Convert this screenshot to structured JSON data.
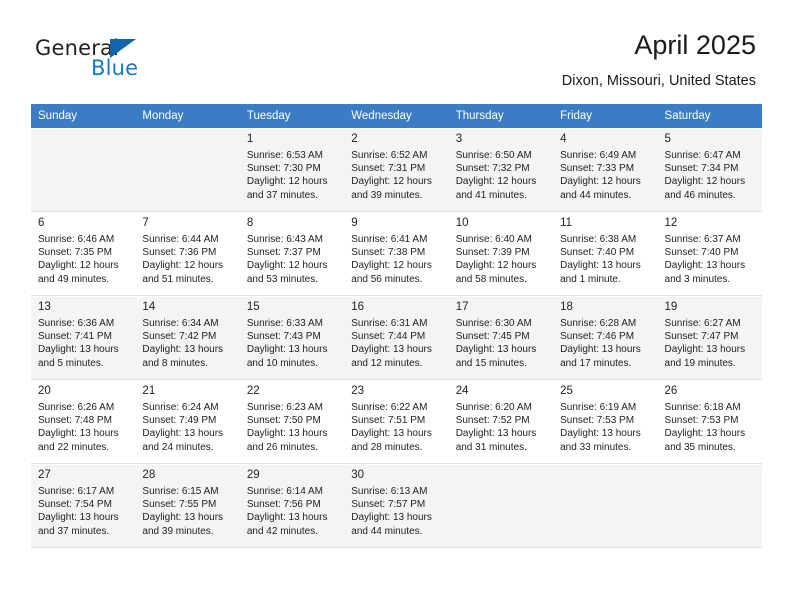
{
  "brand": {
    "name_part1": "General",
    "name_part2": "Blue",
    "logo_icon": "triangle-icon",
    "accent_color": "#1878c8"
  },
  "header": {
    "title": "April 2025",
    "location": "Dixon, Missouri, United States"
  },
  "calendar": {
    "header_bg": "#3b7dc4",
    "columns": [
      "Sunday",
      "Monday",
      "Tuesday",
      "Wednesday",
      "Thursday",
      "Friday",
      "Saturday"
    ],
    "weeks": [
      [
        {
          "day": "",
          "sunrise": "",
          "sunset": "",
          "daylight1": "",
          "daylight2": ""
        },
        {
          "day": "",
          "sunrise": "",
          "sunset": "",
          "daylight1": "",
          "daylight2": ""
        },
        {
          "day": "1",
          "sunrise": "Sunrise: 6:53 AM",
          "sunset": "Sunset: 7:30 PM",
          "daylight1": "Daylight: 12 hours",
          "daylight2": "and 37 minutes."
        },
        {
          "day": "2",
          "sunrise": "Sunrise: 6:52 AM",
          "sunset": "Sunset: 7:31 PM",
          "daylight1": "Daylight: 12 hours",
          "daylight2": "and 39 minutes."
        },
        {
          "day": "3",
          "sunrise": "Sunrise: 6:50 AM",
          "sunset": "Sunset: 7:32 PM",
          "daylight1": "Daylight: 12 hours",
          "daylight2": "and 41 minutes."
        },
        {
          "day": "4",
          "sunrise": "Sunrise: 6:49 AM",
          "sunset": "Sunset: 7:33 PM",
          "daylight1": "Daylight: 12 hours",
          "daylight2": "and 44 minutes."
        },
        {
          "day": "5",
          "sunrise": "Sunrise: 6:47 AM",
          "sunset": "Sunset: 7:34 PM",
          "daylight1": "Daylight: 12 hours",
          "daylight2": "and 46 minutes."
        }
      ],
      [
        {
          "day": "6",
          "sunrise": "Sunrise: 6:46 AM",
          "sunset": "Sunset: 7:35 PM",
          "daylight1": "Daylight: 12 hours",
          "daylight2": "and 49 minutes."
        },
        {
          "day": "7",
          "sunrise": "Sunrise: 6:44 AM",
          "sunset": "Sunset: 7:36 PM",
          "daylight1": "Daylight: 12 hours",
          "daylight2": "and 51 minutes."
        },
        {
          "day": "8",
          "sunrise": "Sunrise: 6:43 AM",
          "sunset": "Sunset: 7:37 PM",
          "daylight1": "Daylight: 12 hours",
          "daylight2": "and 53 minutes."
        },
        {
          "day": "9",
          "sunrise": "Sunrise: 6:41 AM",
          "sunset": "Sunset: 7:38 PM",
          "daylight1": "Daylight: 12 hours",
          "daylight2": "and 56 minutes."
        },
        {
          "day": "10",
          "sunrise": "Sunrise: 6:40 AM",
          "sunset": "Sunset: 7:39 PM",
          "daylight1": "Daylight: 12 hours",
          "daylight2": "and 58 minutes."
        },
        {
          "day": "11",
          "sunrise": "Sunrise: 6:38 AM",
          "sunset": "Sunset: 7:40 PM",
          "daylight1": "Daylight: 13 hours",
          "daylight2": "and 1 minute."
        },
        {
          "day": "12",
          "sunrise": "Sunrise: 6:37 AM",
          "sunset": "Sunset: 7:40 PM",
          "daylight1": "Daylight: 13 hours",
          "daylight2": "and 3 minutes."
        }
      ],
      [
        {
          "day": "13",
          "sunrise": "Sunrise: 6:36 AM",
          "sunset": "Sunset: 7:41 PM",
          "daylight1": "Daylight: 13 hours",
          "daylight2": "and 5 minutes."
        },
        {
          "day": "14",
          "sunrise": "Sunrise: 6:34 AM",
          "sunset": "Sunset: 7:42 PM",
          "daylight1": "Daylight: 13 hours",
          "daylight2": "and 8 minutes."
        },
        {
          "day": "15",
          "sunrise": "Sunrise: 6:33 AM",
          "sunset": "Sunset: 7:43 PM",
          "daylight1": "Daylight: 13 hours",
          "daylight2": "and 10 minutes."
        },
        {
          "day": "16",
          "sunrise": "Sunrise: 6:31 AM",
          "sunset": "Sunset: 7:44 PM",
          "daylight1": "Daylight: 13 hours",
          "daylight2": "and 12 minutes."
        },
        {
          "day": "17",
          "sunrise": "Sunrise: 6:30 AM",
          "sunset": "Sunset: 7:45 PM",
          "daylight1": "Daylight: 13 hours",
          "daylight2": "and 15 minutes."
        },
        {
          "day": "18",
          "sunrise": "Sunrise: 6:28 AM",
          "sunset": "Sunset: 7:46 PM",
          "daylight1": "Daylight: 13 hours",
          "daylight2": "and 17 minutes."
        },
        {
          "day": "19",
          "sunrise": "Sunrise: 6:27 AM",
          "sunset": "Sunset: 7:47 PM",
          "daylight1": "Daylight: 13 hours",
          "daylight2": "and 19 minutes."
        }
      ],
      [
        {
          "day": "20",
          "sunrise": "Sunrise: 6:26 AM",
          "sunset": "Sunset: 7:48 PM",
          "daylight1": "Daylight: 13 hours",
          "daylight2": "and 22 minutes."
        },
        {
          "day": "21",
          "sunrise": "Sunrise: 6:24 AM",
          "sunset": "Sunset: 7:49 PM",
          "daylight1": "Daylight: 13 hours",
          "daylight2": "and 24 minutes."
        },
        {
          "day": "22",
          "sunrise": "Sunrise: 6:23 AM",
          "sunset": "Sunset: 7:50 PM",
          "daylight1": "Daylight: 13 hours",
          "daylight2": "and 26 minutes."
        },
        {
          "day": "23",
          "sunrise": "Sunrise: 6:22 AM",
          "sunset": "Sunset: 7:51 PM",
          "daylight1": "Daylight: 13 hours",
          "daylight2": "and 28 minutes."
        },
        {
          "day": "24",
          "sunrise": "Sunrise: 6:20 AM",
          "sunset": "Sunset: 7:52 PM",
          "daylight1": "Daylight: 13 hours",
          "daylight2": "and 31 minutes."
        },
        {
          "day": "25",
          "sunrise": "Sunrise: 6:19 AM",
          "sunset": "Sunset: 7:53 PM",
          "daylight1": "Daylight: 13 hours",
          "daylight2": "and 33 minutes."
        },
        {
          "day": "26",
          "sunrise": "Sunrise: 6:18 AM",
          "sunset": "Sunset: 7:53 PM",
          "daylight1": "Daylight: 13 hours",
          "daylight2": "and 35 minutes."
        }
      ],
      [
        {
          "day": "27",
          "sunrise": "Sunrise: 6:17 AM",
          "sunset": "Sunset: 7:54 PM",
          "daylight1": "Daylight: 13 hours",
          "daylight2": "and 37 minutes."
        },
        {
          "day": "28",
          "sunrise": "Sunrise: 6:15 AM",
          "sunset": "Sunset: 7:55 PM",
          "daylight1": "Daylight: 13 hours",
          "daylight2": "and 39 minutes."
        },
        {
          "day": "29",
          "sunrise": "Sunrise: 6:14 AM",
          "sunset": "Sunset: 7:56 PM",
          "daylight1": "Daylight: 13 hours",
          "daylight2": "and 42 minutes."
        },
        {
          "day": "30",
          "sunrise": "Sunrise: 6:13 AM",
          "sunset": "Sunset: 7:57 PM",
          "daylight1": "Daylight: 13 hours",
          "daylight2": "and 44 minutes."
        },
        {
          "day": "",
          "sunrise": "",
          "sunset": "",
          "daylight1": "",
          "daylight2": ""
        },
        {
          "day": "",
          "sunrise": "",
          "sunset": "",
          "daylight1": "",
          "daylight2": ""
        },
        {
          "day": "",
          "sunrise": "",
          "sunset": "",
          "daylight1": "",
          "daylight2": ""
        }
      ]
    ]
  }
}
